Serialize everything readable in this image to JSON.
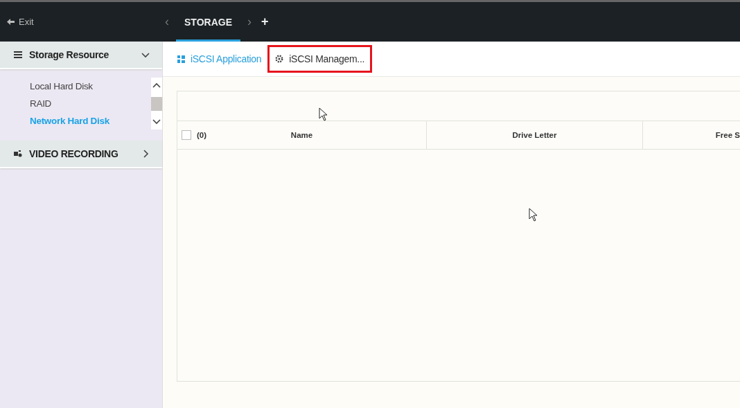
{
  "top_bar": {
    "exit": "Exit",
    "prev": "‹",
    "tabs": [
      {
        "label": "STORAGE",
        "selected": true
      }
    ],
    "next": "›",
    "add": "+"
  },
  "sidebar": {
    "sections": [
      {
        "title": "Storage Resource",
        "expanded": true,
        "items": [
          {
            "label": "Local Hard Disk",
            "selected": false
          },
          {
            "label": "RAID",
            "selected": false
          },
          {
            "label": "Network Hard Disk",
            "selected": true
          }
        ]
      },
      {
        "title": "VIDEO RECORDING",
        "expanded": false
      }
    ]
  },
  "sub_tabs": [
    {
      "label": "iSCSI Application",
      "selected": true,
      "highlighted": false
    },
    {
      "label": "iSCSI Managem...",
      "selected": false,
      "highlighted": true
    }
  ],
  "table": {
    "select_all": {
      "checked": false,
      "count": "(0)"
    },
    "columns": [
      "Name",
      "Drive Letter",
      "Free S"
    ]
  }
}
